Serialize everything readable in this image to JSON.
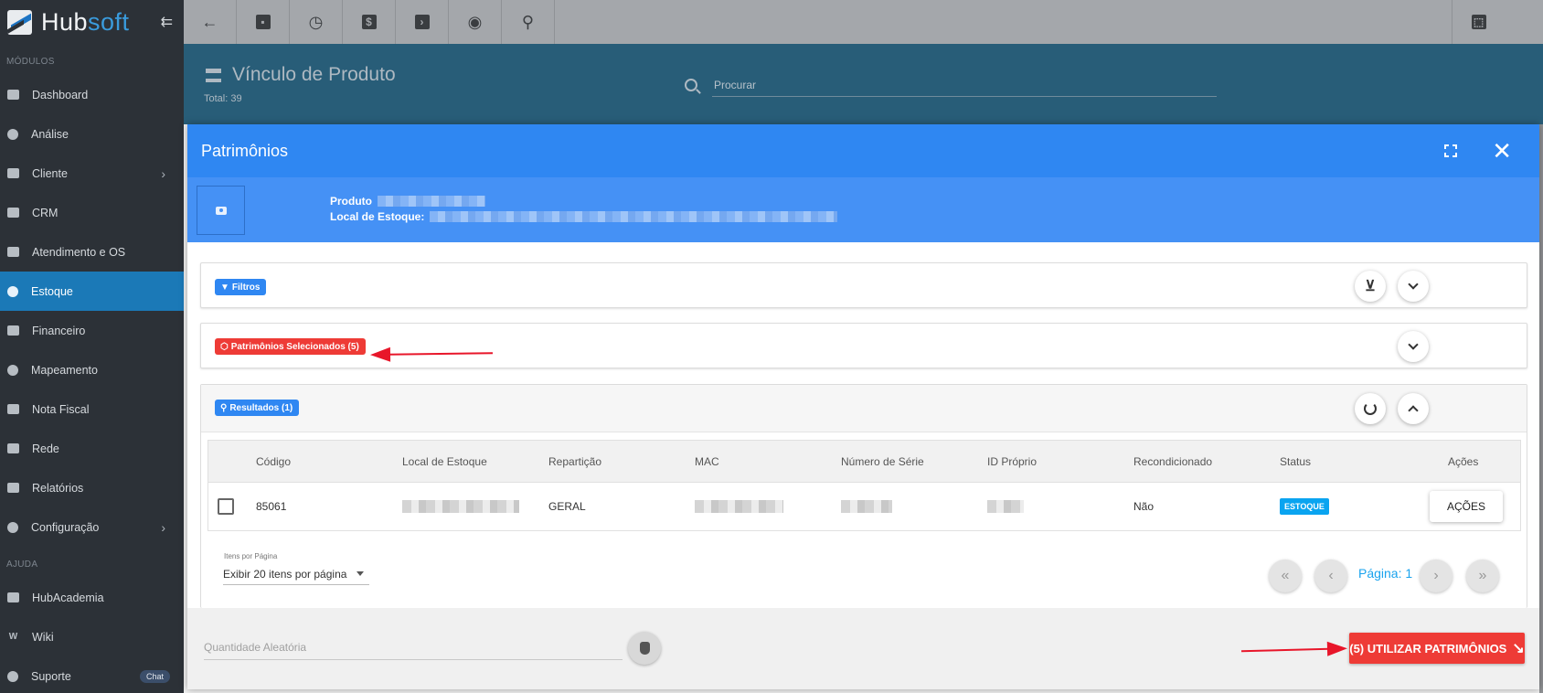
{
  "app": {
    "brand_main": "Hub",
    "brand_accent": "soft"
  },
  "sidebar": {
    "section_modules": "MÓDULOS",
    "section_help": "AJUDA",
    "items": [
      {
        "label": "Dashboard"
      },
      {
        "label": "Análise"
      },
      {
        "label": "Cliente"
      },
      {
        "label": "CRM"
      },
      {
        "label": "Atendimento e OS"
      },
      {
        "label": "Estoque"
      },
      {
        "label": "Financeiro"
      },
      {
        "label": "Mapeamento"
      },
      {
        "label": "Nota Fiscal"
      },
      {
        "label": "Rede"
      },
      {
        "label": "Relatórios"
      },
      {
        "label": "Configuração"
      }
    ],
    "help_items": [
      {
        "label": "HubAcademia"
      },
      {
        "label": "Wiki"
      },
      {
        "label": "Suporte"
      }
    ],
    "chat_badge": "Chat",
    "wiki_letter": "W"
  },
  "header": {
    "title": "Vínculo de Produto",
    "total": "Total: 39",
    "search_placeholder": "Procurar"
  },
  "modal": {
    "title": "Patrimônios",
    "product_label": "Produto",
    "stock_location_label": "Local de Estoque:",
    "filters_label": "Filtros",
    "selected_label": "Patrimônios Selecionados (5)",
    "results_label": "Resultados (1)",
    "columns": [
      "Código",
      "Local de Estoque",
      "Repartição",
      "MAC",
      "Número de Série",
      "ID Próprio",
      "Recondicionado",
      "Status",
      "Ações"
    ],
    "rows": [
      {
        "codigo": "85061",
        "reparticao": "GERAL",
        "recondicionado": "Não",
        "status": "ESTOQUE",
        "acoes": "AÇÕES"
      }
    ],
    "per_page_label": "Itens por Página",
    "per_page_value": "Exibir 20 itens por página",
    "page_label": "Página: 1",
    "random_qty_placeholder": "Quantidade Aleatória",
    "use_button": "(5) UTILIZAR PATRIMÔNIOS"
  },
  "colors": {
    "accent_blue": "#2f87f2",
    "danger_red": "#ee3b36",
    "sidebar_bg": "#2c3137",
    "active_nav": "#1b79b7"
  }
}
